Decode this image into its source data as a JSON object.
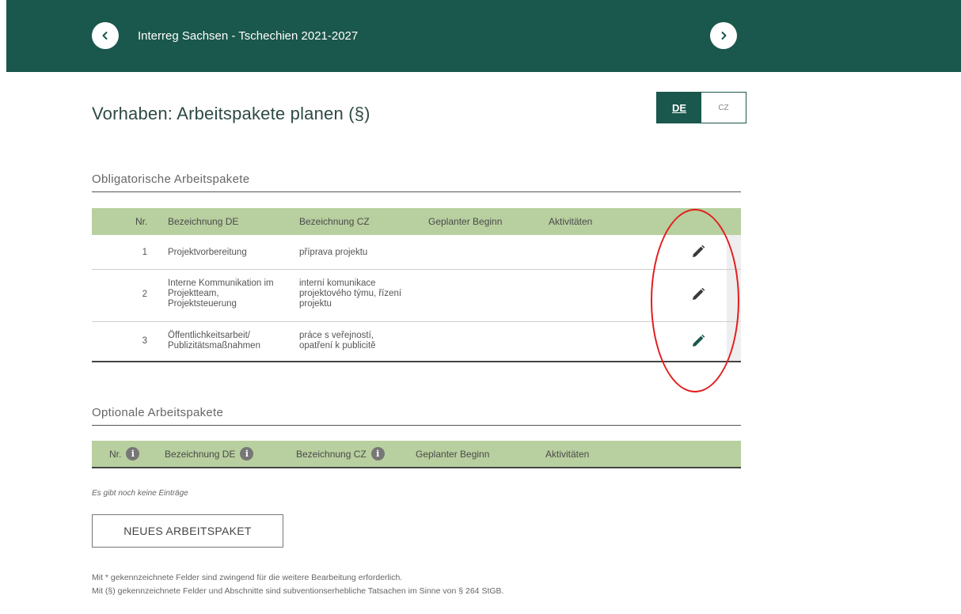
{
  "header": {
    "title": "Interreg Sachsen - Tschechien 2021-2027",
    "prev_icon": "chevron-left-icon",
    "next_icon": "chevron-right-icon",
    "background_color": "#1a574c"
  },
  "page": {
    "title": "Vorhaben: Arbeitspakete planen (§)"
  },
  "language_switch": {
    "de": "DE",
    "cz": "CZ",
    "active": "DE"
  },
  "obligatory": {
    "title": "Obligatorische Arbeitspakete",
    "columns": [
      "Nr.",
      "Bezeichnung DE",
      "Bezeichnung CZ",
      "Geplanter Beginn",
      "Aktivitäten"
    ],
    "rows": [
      {
        "nr": "1",
        "de": "Projektvorbereitung",
        "cz": "příprava projektu",
        "edit_icon": "pencil-icon"
      },
      {
        "nr": "2",
        "de": "Interne Kommunikation im Projektteam, Projektsteuerung",
        "cz": "interní komunikace projektového týmu, řízení projektu",
        "edit_icon": "pencil-icon"
      },
      {
        "nr": "3",
        "de": "Öffentlichkeitsarbeit/ Publizitätsmaßnahmen",
        "cz": "práce s veřejností, opatření k publicitě",
        "edit_icon": "pencil-icon"
      }
    ]
  },
  "optional": {
    "title": "Optionale Arbeitspakete",
    "columns": [
      "Nr.",
      "Bezeichnung DE",
      "Bezeichnung CZ",
      "Geplanter Beginn",
      "Aktivitäten"
    ],
    "info_icon": "info-icon",
    "empty_text": "Es gibt noch keine Einträge"
  },
  "new_button": "NEUES ARBEITSPAKET",
  "footnotes": [
    "Mit * gekennzeichnete Felder sind zwingend für die weitere Bearbeitung erforderlich.",
    "Mit (§) gekennzeichnete Felder und Abschnitte sind subventionserhebliche Tatsachen im Sinne von § 264 StGB."
  ],
  "colors": {
    "brand": "#1a574c",
    "table_header": "#b8cf9f",
    "annotation": "#e31d1d"
  }
}
